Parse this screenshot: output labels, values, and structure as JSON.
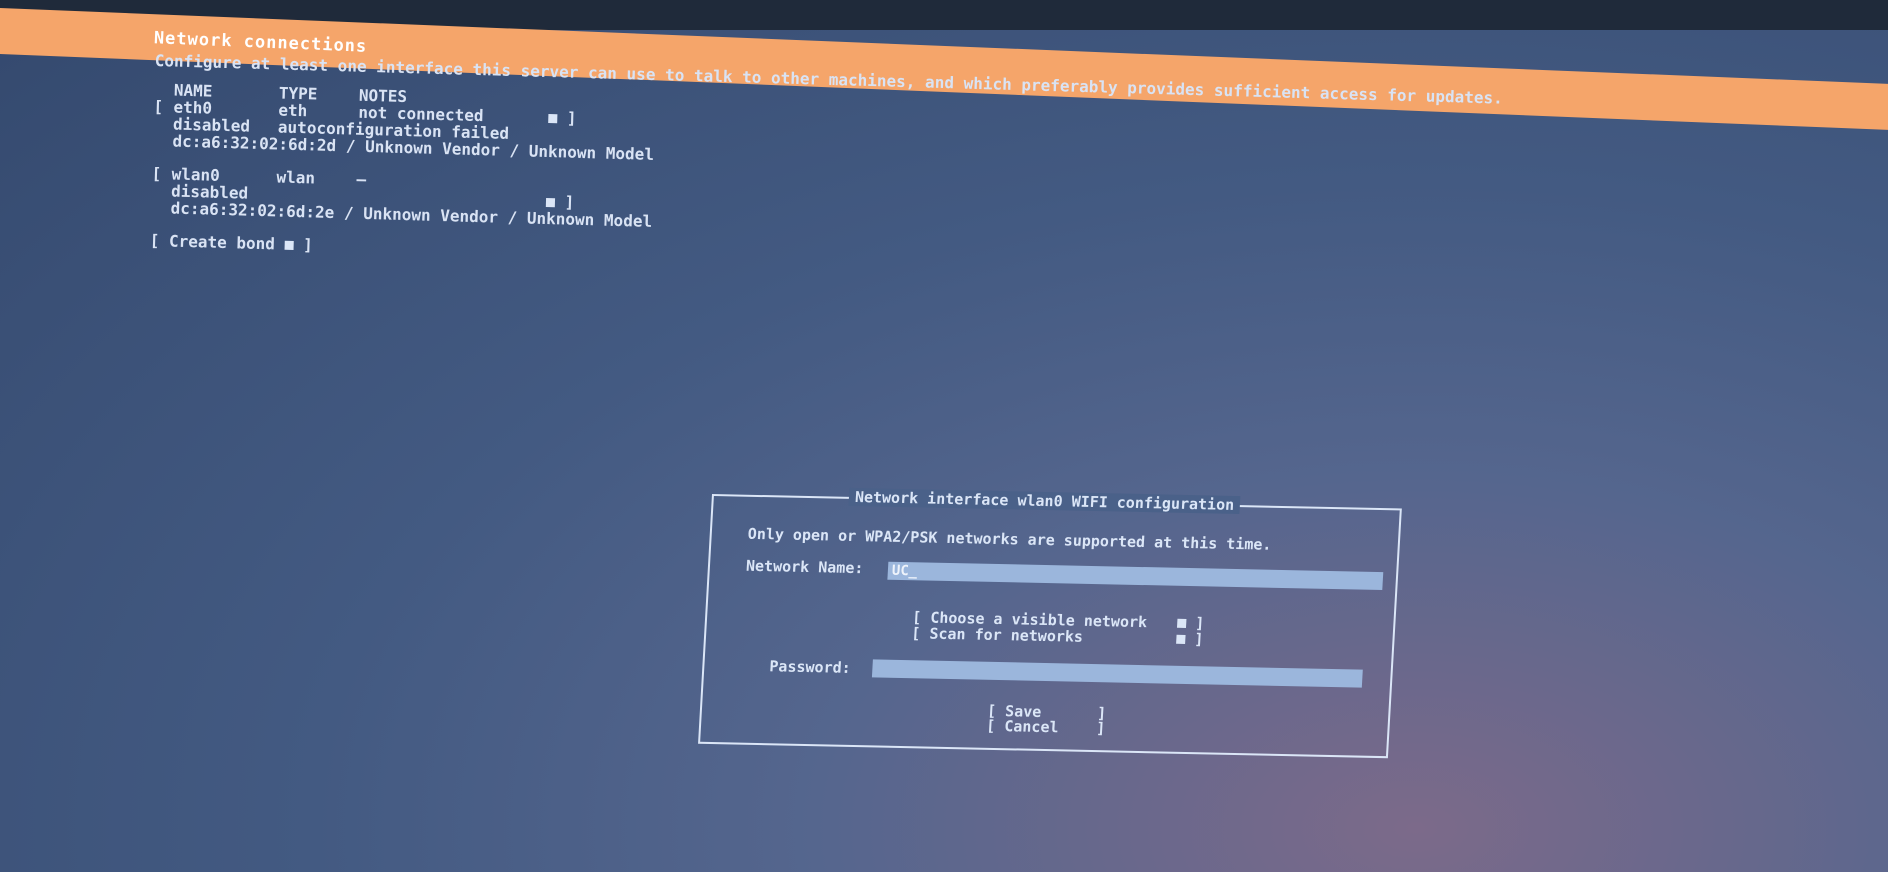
{
  "header": {
    "title": "Network connections"
  },
  "intro": "Configure at least one interface this server can use to talk to other machines, and which preferably provides sufficient access for updates.",
  "table": {
    "headers": [
      "NAME",
      "TYPE",
      "NOTES"
    ],
    "interfaces": [
      {
        "name": "eth0",
        "type": "eth",
        "notes": "not connected",
        "status": "disabled",
        "status_note": "autoconfiguration failed",
        "hardware": "dc:a6:32:02:6d:2d / Unknown Vendor / Unknown Model"
      },
      {
        "name": "wlan0",
        "type": "wlan",
        "notes": "–",
        "status": "disabled",
        "status_note": "",
        "hardware": "dc:a6:32:02:6d:2e / Unknown Vendor / Unknown Model"
      }
    ],
    "create_bond_label": "Create bond"
  },
  "dialog": {
    "title": "Network interface wlan0 WIFI configuration",
    "note": "Only open or WPA2/PSK networks are supported at this time.",
    "network_name_label": "Network Name:",
    "network_name_value": "UC_",
    "choose_visible_label": "Choose a visible network",
    "scan_label": "Scan for networks",
    "password_label": "Password:",
    "password_value": "",
    "save_label": "Save",
    "cancel_label": "Cancel"
  },
  "colors": {
    "header_bar": "#f5a56a",
    "background": "#3b4f74",
    "text": "#d9e3f4",
    "input_fill": "#9bb6dc"
  }
}
